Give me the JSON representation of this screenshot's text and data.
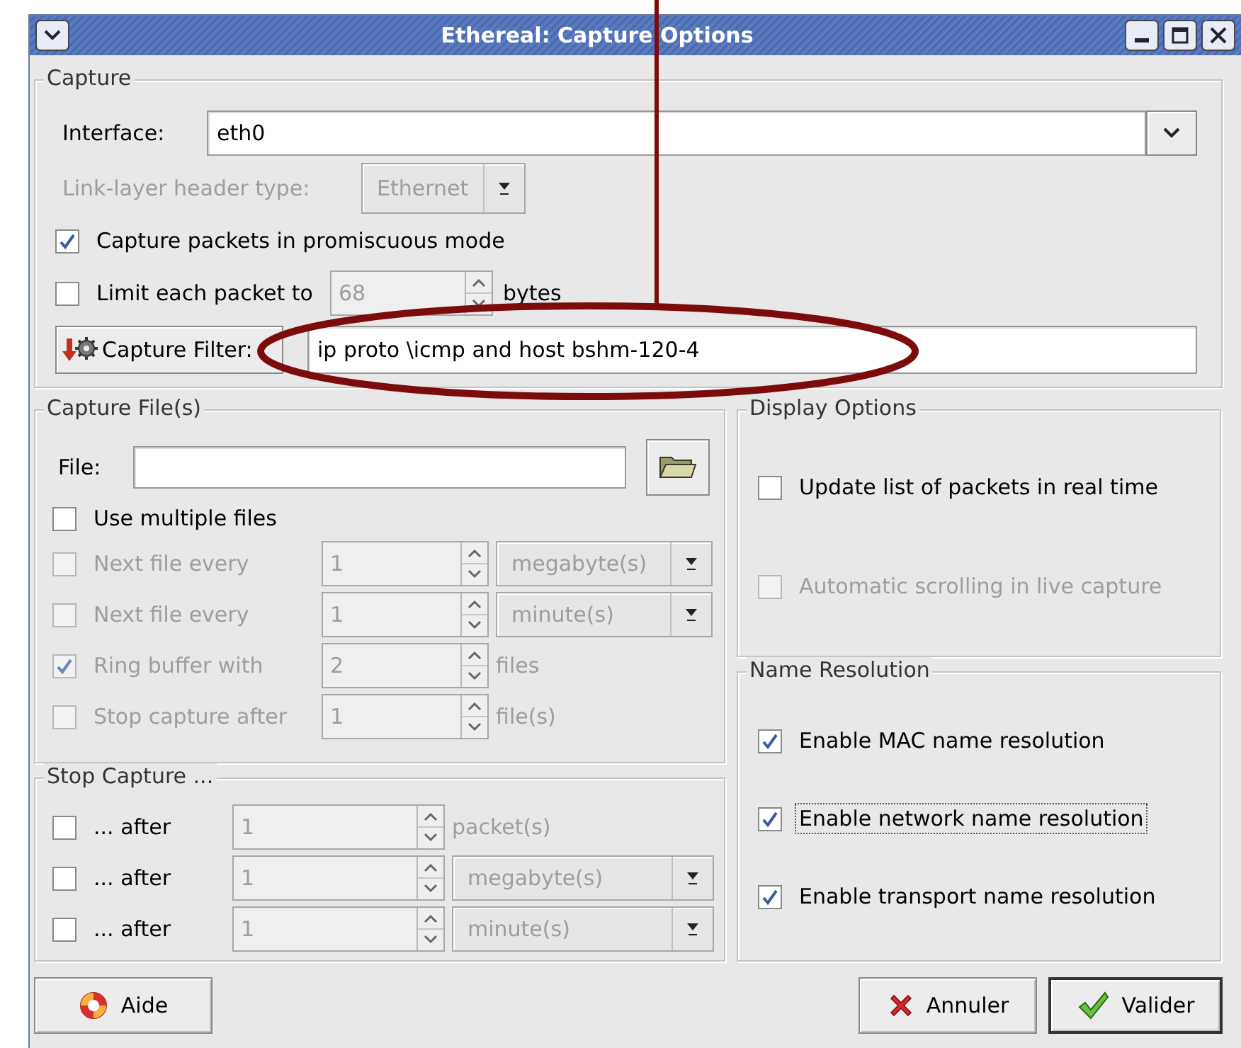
{
  "window": {
    "title": "Ethereal: Capture Options"
  },
  "capture": {
    "title": "Capture",
    "interface": {
      "label": "Interface:",
      "value": "eth0"
    },
    "link_layer": {
      "label": "Link-layer header type:",
      "value": "Ethernet",
      "disabled": true
    },
    "promiscuous": {
      "label": "Capture packets in promiscuous mode",
      "checked": true
    },
    "limit": {
      "label": "Limit each packet to",
      "checked": false,
      "value": "68",
      "unit": "bytes"
    },
    "filter": {
      "button": "Capture Filter:",
      "value": "ip proto \\icmp and host bshm-120-4"
    }
  },
  "capture_files": {
    "title": "Capture File(s)",
    "file": {
      "label": "File:"
    },
    "rows": [
      {
        "kind": "check",
        "label": "Use multiple files",
        "checked": false,
        "disabled": false
      },
      {
        "kind": "spin_combo",
        "label": "Next file every",
        "checked": false,
        "disabled": true,
        "value": "1",
        "unit": "megabyte(s)"
      },
      {
        "kind": "spin_combo",
        "label": "Next file every",
        "checked": false,
        "disabled": true,
        "value": "1",
        "unit": "minute(s)"
      },
      {
        "kind": "spin_unit",
        "label": "Ring buffer with",
        "checked": true,
        "disabled": true,
        "value": "2",
        "unit": "files"
      },
      {
        "kind": "spin_unit",
        "label": "Stop capture after",
        "checked": false,
        "disabled": true,
        "value": "1",
        "unit": "file(s)"
      }
    ]
  },
  "stop_capture": {
    "title": "Stop Capture ...",
    "rows": [
      {
        "kind": "spin_unit",
        "label": "... after",
        "checked": false,
        "disabled": false,
        "value": "1",
        "unit": "packet(s)"
      },
      {
        "kind": "spin_combo",
        "label": "... after",
        "checked": false,
        "disabled": false,
        "value": "1",
        "unit": "megabyte(s)"
      },
      {
        "kind": "spin_combo",
        "label": "... after",
        "checked": false,
        "disabled": false,
        "value": "1",
        "unit": "minute(s)"
      }
    ]
  },
  "display_options": {
    "title": "Display Options",
    "items": [
      {
        "label": "Update list of packets in real time",
        "checked": false,
        "disabled": false
      },
      {
        "label": "Automatic scrolling in live capture",
        "checked": false,
        "disabled": true
      }
    ]
  },
  "name_resolution": {
    "title": "Name Resolution",
    "items": [
      {
        "label": "Enable MAC name resolution",
        "checked": true,
        "focused": false
      },
      {
        "label": "Enable network name resolution",
        "checked": true,
        "focused": true
      },
      {
        "label": "Enable transport name resolution",
        "checked": true,
        "focused": false
      }
    ]
  },
  "buttons": [
    {
      "kind": "help",
      "label": "Aide",
      "default": false
    },
    {
      "kind": "cancel",
      "label": "Annuler",
      "default": false
    },
    {
      "kind": "ok",
      "label": "Valider",
      "default": true
    }
  ],
  "annotation": {
    "kind": "ellipse"
  }
}
